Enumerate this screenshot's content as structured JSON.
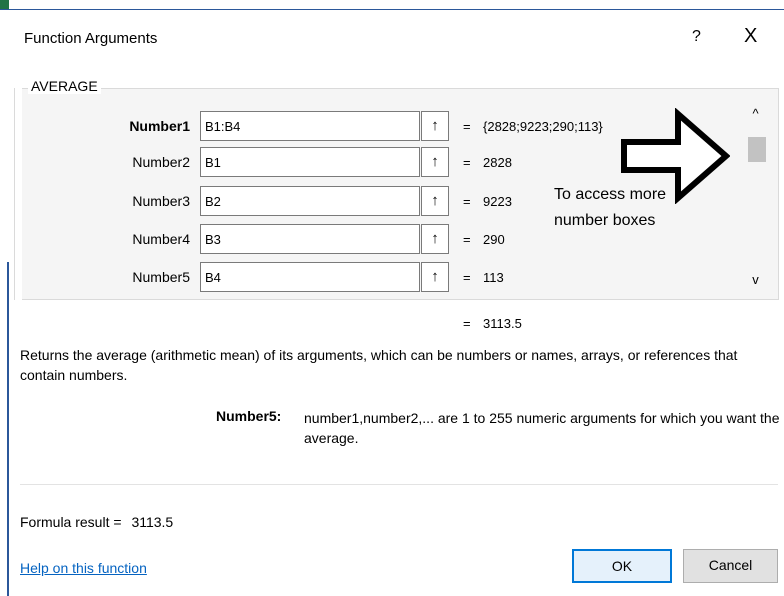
{
  "window": {
    "title": "Function Arguments",
    "help_glyph": "?",
    "close_glyph": "X"
  },
  "function_name": "AVERAGE",
  "arguments": [
    {
      "label": "Number1",
      "value": "B1:B4",
      "result": "{2828;9223;290;113}"
    },
    {
      "label": "Number2",
      "value": "B1",
      "result": "2828"
    },
    {
      "label": "Number3",
      "value": "B2",
      "result": "9223"
    },
    {
      "label": "Number4",
      "value": "B3",
      "result": "290"
    },
    {
      "label": "Number5",
      "value": "B4",
      "result": "113"
    }
  ],
  "equals": "=",
  "ref_button_glyph": "↑",
  "scroll": {
    "up_glyph": "^",
    "down_glyph": "v"
  },
  "annotation": {
    "line1": "To access more",
    "line2": "number boxes"
  },
  "overall_result": "3113.5",
  "description": "Returns the average (arithmetic mean) of its arguments, which can be numbers or names, arrays, or references that contain numbers.",
  "arg_help": {
    "label": "Number5:",
    "text": "number1,number2,... are 1 to 255 numeric arguments for which you want the average."
  },
  "formula_result": {
    "label": "Formula result =",
    "value": "3113.5"
  },
  "help_link": "Help on this function",
  "buttons": {
    "ok": "OK",
    "cancel": "Cancel"
  },
  "colors": {
    "accent": "#0078d7",
    "link": "#0563c1"
  },
  "icons": [
    "collapse-dialog-icon",
    "scroll-up-icon",
    "scroll-down-icon",
    "close-icon",
    "help-icon",
    "arrow-annotation-icon"
  ]
}
